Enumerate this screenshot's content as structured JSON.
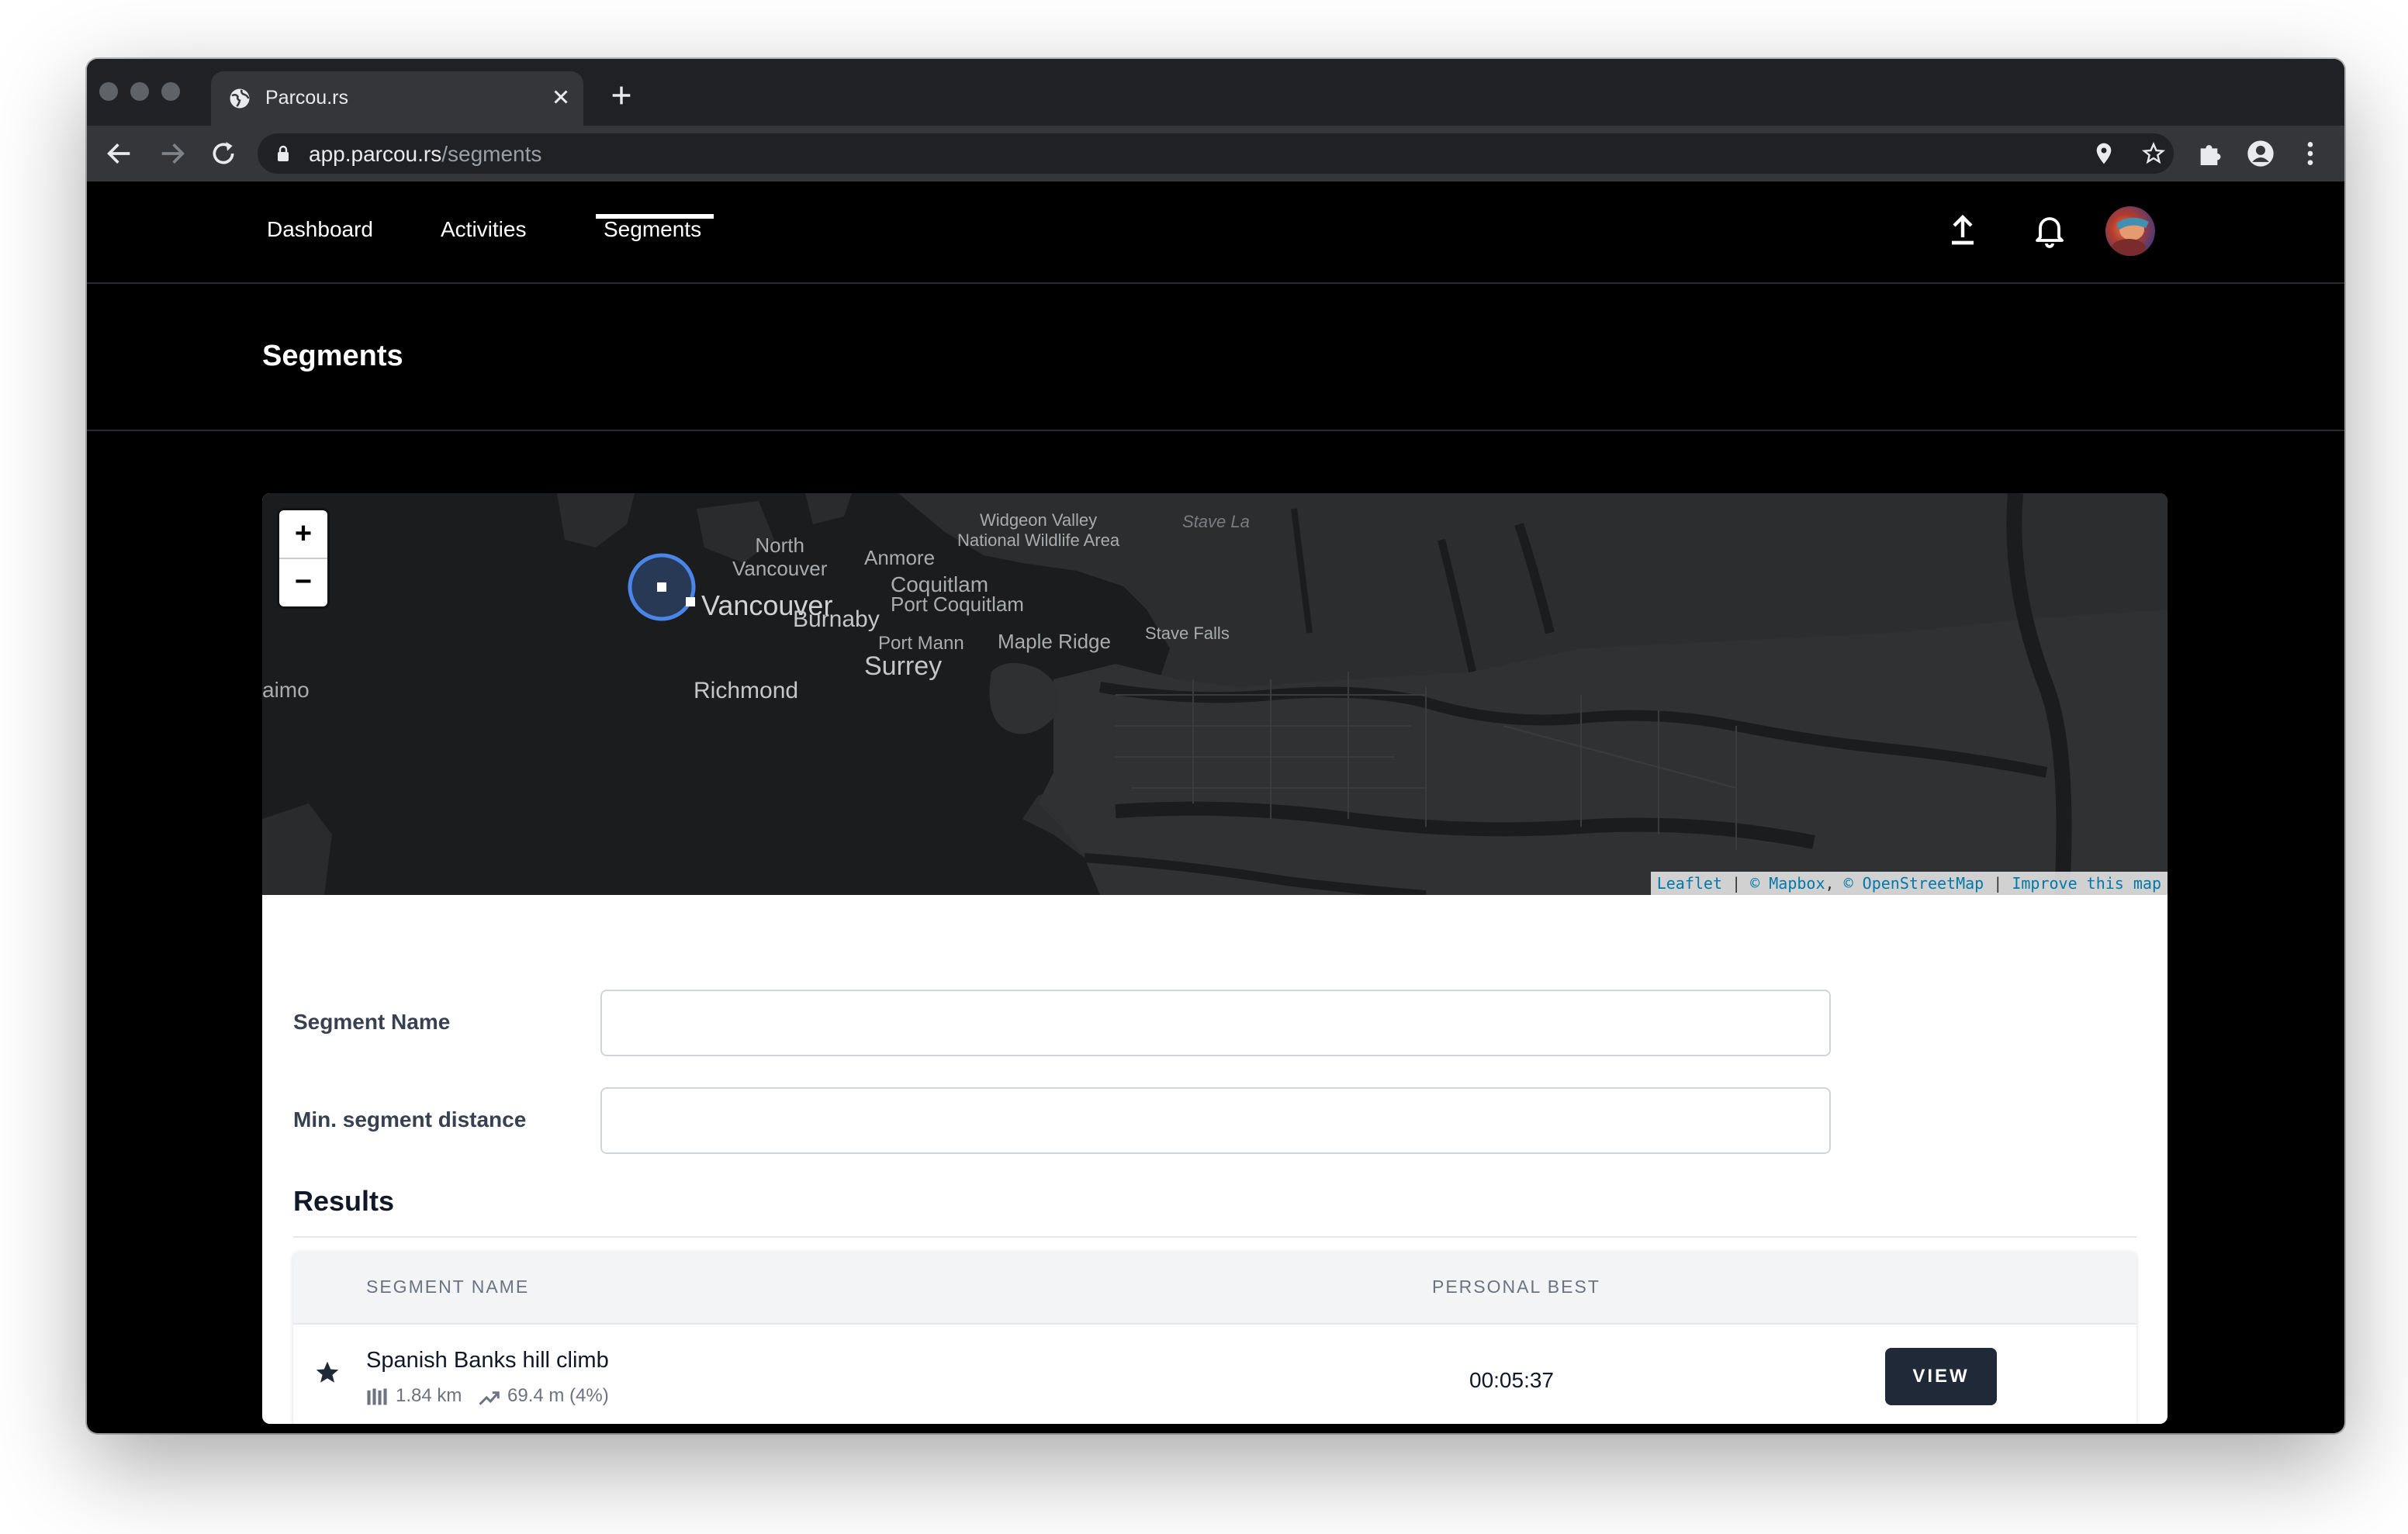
{
  "browser": {
    "tab_title": "Parcou.rs",
    "url_host": "app.parcou.rs",
    "url_path": "/segments"
  },
  "nav": {
    "items": [
      {
        "label": "Dashboard"
      },
      {
        "label": "Activities"
      },
      {
        "label": "Segments",
        "active": true
      }
    ],
    "icons": [
      "upload-icon",
      "bell-icon",
      "avatar"
    ]
  },
  "page": {
    "title": "Segments"
  },
  "map": {
    "zoom_in": "+",
    "zoom_out": "−",
    "labels": {
      "north_vancouver": "North\nVancouver",
      "vancouver": "Vancouver",
      "burnaby": "Burnaby",
      "anmore": "Anmore",
      "coquitlam": "Coquitlam",
      "port_coquitlam": "Port Coquitlam",
      "port_mann": "Port Mann",
      "surrey": "Surrey",
      "maple_ridge": "Maple Ridge",
      "stave_falls": "Stave Falls",
      "widgeon": "Widgeon Valley\nNational Wildlife Area",
      "stave_lake": "Stave La",
      "richmond": "Richmond",
      "nanaimo": "aimo"
    },
    "attribution": {
      "leaflet": "Leaflet",
      "mapbox": "© Mapbox",
      "osm": "© OpenStreetMap",
      "improve": "Improve this map"
    },
    "colors": {
      "circle": "#4a86e8",
      "land": "#2b2c2d",
      "water": "#1b1c1d"
    }
  },
  "form": {
    "segment_name_label": "Segment Name",
    "segment_name_value": "",
    "min_distance_label": "Min. segment distance",
    "min_distance_value": ""
  },
  "results": {
    "title": "Results",
    "columns": {
      "name": "SEGMENT NAME",
      "personal_best": "PERSONAL BEST"
    },
    "rows": [
      {
        "name": "Spanish Banks hill climb",
        "distance": "1.84 km",
        "elevation": "69.4 m (4%)",
        "personal_best": "00:05:37",
        "action": "VIEW",
        "starred": true
      }
    ]
  }
}
